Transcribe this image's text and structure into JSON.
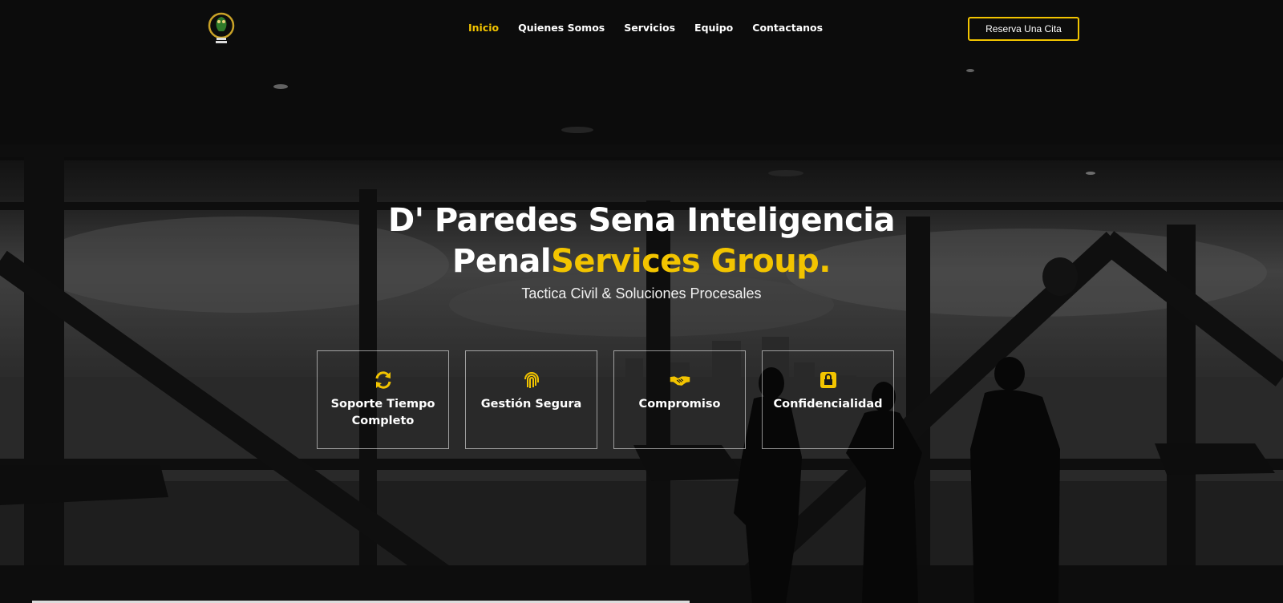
{
  "nav": {
    "items": [
      {
        "label": "Inicio",
        "active": true
      },
      {
        "label": "Quienes Somos",
        "active": false
      },
      {
        "label": "Servicios",
        "active": false
      },
      {
        "label": "Equipo",
        "active": false
      },
      {
        "label": "Contactanos",
        "active": false
      }
    ],
    "cta_label": "Reserva Una Cita"
  },
  "hero": {
    "title_line1": "D' Paredes Sena Inteligencia",
    "title_line2_white": "Penal",
    "title_line2_accent": "Services Group.",
    "subtitle": "Tactica Civil & Soluciones Procesales"
  },
  "features": [
    {
      "label": "Soporte Tiempo Completo",
      "icon": "sync-icon"
    },
    {
      "label": "Gestión Segura",
      "icon": "fingerprint-icon"
    },
    {
      "label": "Compromiso",
      "icon": "handshake-icon"
    },
    {
      "label": "Confidencialidad",
      "icon": "lock-icon"
    }
  ],
  "colors": {
    "accent": "#f2c400",
    "text": "#ffffff",
    "background": "#0b0b0b"
  }
}
